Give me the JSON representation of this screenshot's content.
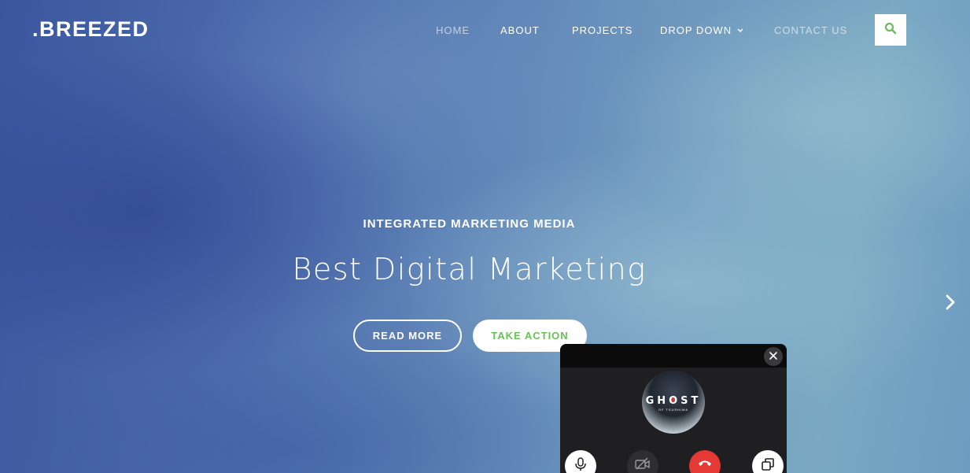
{
  "brand": {
    "logo": ".BREEZED"
  },
  "nav": {
    "items": [
      {
        "label": "HOME"
      },
      {
        "label": "ABOUT"
      },
      {
        "label": "PROJECTS"
      },
      {
        "label": "DROP DOWN"
      },
      {
        "label": "CONTACT US"
      }
    ]
  },
  "hero": {
    "subtitle": "INTEGRATED MARKETING MEDIA",
    "title": "Best Digital Marketing",
    "read_more_label": "READ MORE",
    "take_action_label": "TAKE ACTION"
  },
  "call_popup": {
    "avatar_text": "GHOST",
    "avatar_subtext": "OF TSUSHIMA"
  },
  "colors": {
    "accent_green": "#6abf5b",
    "end_call_red": "#e53935",
    "popup_bg": "#1f1f21"
  },
  "icons": {
    "search": "search-icon",
    "chevron": "chevron-down-icon",
    "next": "chevron-right-icon",
    "close": "close-icon",
    "mic": "microphone-icon",
    "camera_off": "camera-off-icon",
    "end_call": "phone-hangup-icon",
    "popout": "window-restore-icon"
  }
}
